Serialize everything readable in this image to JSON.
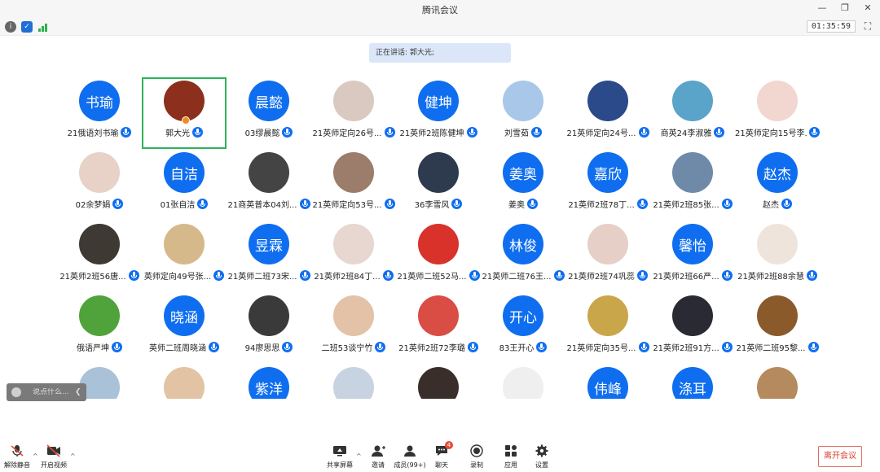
{
  "window": {
    "title": "腾讯会议"
  },
  "status": {
    "timer": "01:35:59"
  },
  "speaking": {
    "text": "正在讲话: 郭大光;"
  },
  "participants": [
    {
      "name": "21俄语刘书瑜",
      "avatar_text": "书瑜",
      "avatar_color": "#0f6ef0"
    },
    {
      "name": "郭大光",
      "avatar_text": "",
      "avatar_color": "#8c2f1d"
    },
    {
      "name": "03缪晨懿",
      "avatar_text": "晨懿",
      "avatar_color": "#0f6ef0"
    },
    {
      "name": "21英师定向26号...",
      "avatar_text": "",
      "avatar_color": "#d9c9c0"
    },
    {
      "name": "21英师2班陈健坤",
      "avatar_text": "健坤",
      "avatar_color": "#0f6ef0"
    },
    {
      "name": "刘雪茹",
      "avatar_text": "",
      "avatar_color": "#a9c7e8"
    },
    {
      "name": "21英师定向24号...",
      "avatar_text": "",
      "avatar_color": "#2b4a8a"
    },
    {
      "name": "商英24李淑雅",
      "avatar_text": "",
      "avatar_color": "#5aa3c9"
    },
    {
      "name": "21英师定向15号李...",
      "avatar_text": "",
      "avatar_color": "#f1d7cf"
    },
    {
      "name": "02余梦娟",
      "avatar_text": "",
      "avatar_color": "#e8d2c7"
    },
    {
      "name": "01张自洁",
      "avatar_text": "自洁",
      "avatar_color": "#0f6ef0"
    },
    {
      "name": "21商英普本04刘...",
      "avatar_text": "",
      "avatar_color": "#444444"
    },
    {
      "name": "21英师定向53号...",
      "avatar_text": "",
      "avatar_color": "#9c7c6a"
    },
    {
      "name": "36李雪风",
      "avatar_text": "",
      "avatar_color": "#2e3a4e"
    },
    {
      "name": "姜奥",
      "avatar_text": "姜奥",
      "avatar_color": "#0f6ef0"
    },
    {
      "name": "21英师2班78丁...",
      "avatar_text": "嘉欣",
      "avatar_color": "#0f6ef0"
    },
    {
      "name": "21英师2班85张...",
      "avatar_text": "",
      "avatar_color": "#6f8aa8"
    },
    {
      "name": "赵杰",
      "avatar_text": "赵杰",
      "avatar_color": "#0f6ef0"
    },
    {
      "name": "21英师2班56唐...",
      "avatar_text": "",
      "avatar_color": "#3e3a33"
    },
    {
      "name": "英师定向49号张...",
      "avatar_text": "",
      "avatar_color": "#d6b98a"
    },
    {
      "name": "21英师二班73宋...",
      "avatar_text": "昱霖",
      "avatar_color": "#0f6ef0"
    },
    {
      "name": "21英师2班84丁...",
      "avatar_text": "",
      "avatar_color": "#e8d6d1"
    },
    {
      "name": "21英师二班52马...",
      "avatar_text": "",
      "avatar_color": "#d8322b"
    },
    {
      "name": "21英师二班76王...",
      "avatar_text": "林俊",
      "avatar_color": "#0f6ef0"
    },
    {
      "name": "21英师2班74巩蕊",
      "avatar_text": "",
      "avatar_color": "#e6cfc6"
    },
    {
      "name": "21英师2班66严...",
      "avatar_text": "馨怡",
      "avatar_color": "#0f6ef0"
    },
    {
      "name": "21英师2班88余慧",
      "avatar_text": "",
      "avatar_color": "#efe4dc"
    },
    {
      "name": "俄语严坤",
      "avatar_text": "",
      "avatar_color": "#4fa33a"
    },
    {
      "name": "英师二班周晓涵",
      "avatar_text": "晓涵",
      "avatar_color": "#0f6ef0"
    },
    {
      "name": "94廖思思",
      "avatar_text": "",
      "avatar_color": "#3a3a3a"
    },
    {
      "name": "二班53谈宁竹",
      "avatar_text": "",
      "avatar_color": "#e3c2a8"
    },
    {
      "name": "21英师2班72李璐",
      "avatar_text": "",
      "avatar_color": "#d94d45"
    },
    {
      "name": "83王开心",
      "avatar_text": "开心",
      "avatar_color": "#0f6ef0"
    },
    {
      "name": "21英师定向35号...",
      "avatar_text": "",
      "avatar_color": "#c9a64a"
    },
    {
      "name": "21英师2班91方...",
      "avatar_text": "",
      "avatar_color": "#2a2a34"
    },
    {
      "name": "21英师二班95黎...",
      "avatar_text": "",
      "avatar_color": "#8a5a2a"
    },
    {
      "name": "",
      "avatar_text": "",
      "avatar_color": "#a9c2d8"
    },
    {
      "name": "",
      "avatar_text": "",
      "avatar_color": "#e2c3a3"
    },
    {
      "name": "",
      "avatar_text": "紫洋",
      "avatar_color": "#0f6ef0"
    },
    {
      "name": "",
      "avatar_text": "",
      "avatar_color": "#c7d3e0"
    },
    {
      "name": "",
      "avatar_text": "",
      "avatar_color": "#3a2e2a"
    },
    {
      "name": "",
      "avatar_text": "",
      "avatar_color": "#efefef"
    },
    {
      "name": "",
      "avatar_text": "伟峰",
      "avatar_color": "#0f6ef0"
    },
    {
      "name": "",
      "avatar_text": "涤耳",
      "avatar_color": "#0f6ef0"
    },
    {
      "name": "",
      "avatar_text": "",
      "avatar_color": "#b58a5e"
    }
  ],
  "chat": {
    "placeholder": "说点什么..."
  },
  "toolbar": {
    "mute": "解除静音",
    "video": "开启视频",
    "share": "共享屏幕",
    "invite": "邀请",
    "members": "成员(99+)",
    "chat": "聊天",
    "chat_badge": "4",
    "record": "录制",
    "apps": "应用",
    "settings": "设置",
    "leave": "离开会议"
  },
  "colors": {
    "accent": "#0f6ef0",
    "active_border": "#2eb35a",
    "leave": "#d8402f"
  }
}
